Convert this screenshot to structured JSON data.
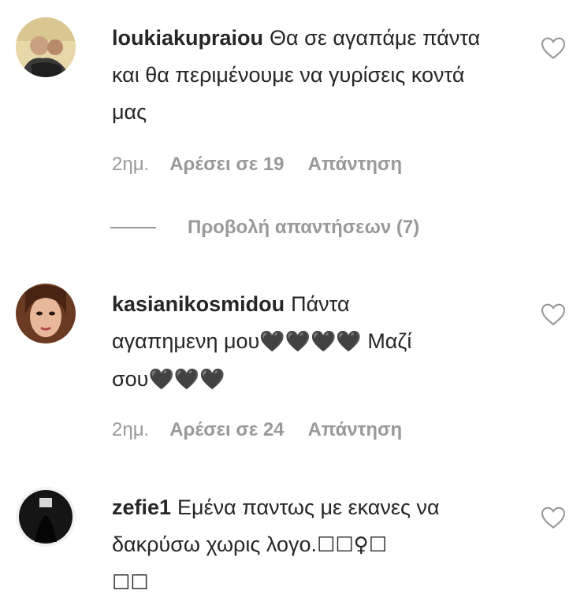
{
  "comments": [
    {
      "username": "loukiakupraiou",
      "text": "Θα σε αγαπάμε πάντα και θα περιμένουμε να γυρίσεις κοντά μας",
      "time": "2ημ.",
      "likes": "Αρέσει σε 19",
      "reply": "Απάντηση",
      "view_replies": "Προβολή απαντήσεων (7)"
    },
    {
      "username": "kasianikosmidou",
      "text_line1": "Πάντα",
      "text_line2_a": "αγαπημενη μου",
      "hearts_a": "🖤🖤🖤🖤",
      "text_line2_b": " Μαζί",
      "text_line3_a": "σου",
      "hearts_b": "🖤🖤🖤",
      "time": "2ημ.",
      "likes": "Αρέσει σε 24",
      "reply": "Απάντηση"
    },
    {
      "username": "zefie1",
      "text_a": "Εμένα παντως με εκανες να δακρύσω χωρις λογο.",
      "glyphs_a": "☐☐♀☐",
      "glyphs_b": "☐☐"
    }
  ],
  "icons": {
    "like": "heart-outline-icon"
  },
  "colors": {
    "text": "#262626",
    "secondary": "#999999"
  }
}
